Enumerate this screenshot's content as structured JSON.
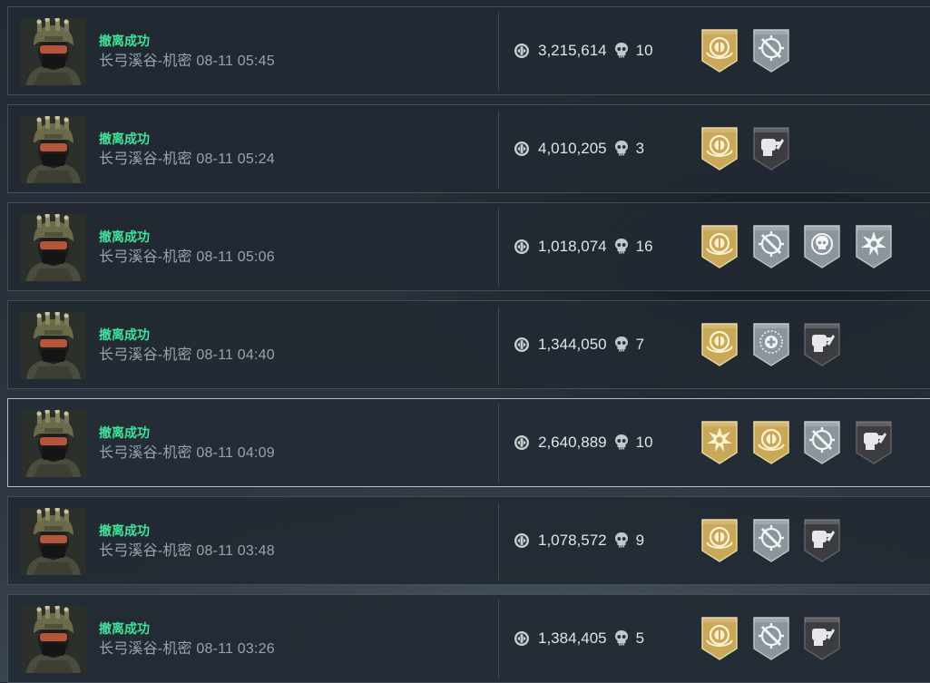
{
  "records": [
    {
      "status": "撤离成功",
      "map": "长弓溪谷-机密",
      "time": "08-11 05:45",
      "coins": "3,215,614",
      "kills": "10",
      "badges": [
        "gold-crest-badge",
        "gray-crosshair-badge"
      ]
    },
    {
      "status": "撤离成功",
      "map": "长弓溪谷-机密",
      "time": "08-11 05:24",
      "coins": "4,010,205",
      "kills": "3",
      "badges": [
        "gold-crest-badge",
        "dark-fist-badge"
      ]
    },
    {
      "status": "撤离成功",
      "map": "长弓溪谷-机密",
      "time": "08-11 05:06",
      "coins": "1,018,074",
      "kills": "16",
      "badges": [
        "gold-crest-badge",
        "gray-crosshair-badge",
        "gray-skull-target-badge",
        "gray-burst-badge"
      ]
    },
    {
      "status": "撤离成功",
      "map": "长弓溪谷-机密",
      "time": "08-11 04:40",
      "coins": "1,344,050",
      "kills": "7",
      "badges": [
        "gold-crest-badge",
        "gray-medkit-badge",
        "dark-fist-badge"
      ]
    },
    {
      "status": "撤离成功",
      "map": "长弓溪谷-机密",
      "time": "08-11 04:09",
      "coins": "2,640,889",
      "kills": "10",
      "badges": [
        "gold-burst-badge",
        "gold-crest-badge",
        "gray-crosshair-badge",
        "dark-fist-badge"
      ]
    },
    {
      "status": "撤离成功",
      "map": "长弓溪谷-机密",
      "time": "08-11 03:48",
      "coins": "1,078,572",
      "kills": "9",
      "badges": [
        "gold-crest-badge",
        "gray-crosshair-badge",
        "dark-fist-badge"
      ]
    },
    {
      "status": "撤离成功",
      "map": "长弓溪谷-机密",
      "time": "08-11 03:26",
      "coins": "1,384,405",
      "kills": "5",
      "badges": [
        "gold-crest-badge",
        "gray-crosshair-badge",
        "dark-fist-badge"
      ]
    }
  ],
  "selected_index": 4,
  "colors": {
    "status_success": "#3fe39a",
    "badge_gold": "#c9a85a",
    "badge_gray": "#8b969c",
    "badge_dark": "#3b3d41"
  }
}
